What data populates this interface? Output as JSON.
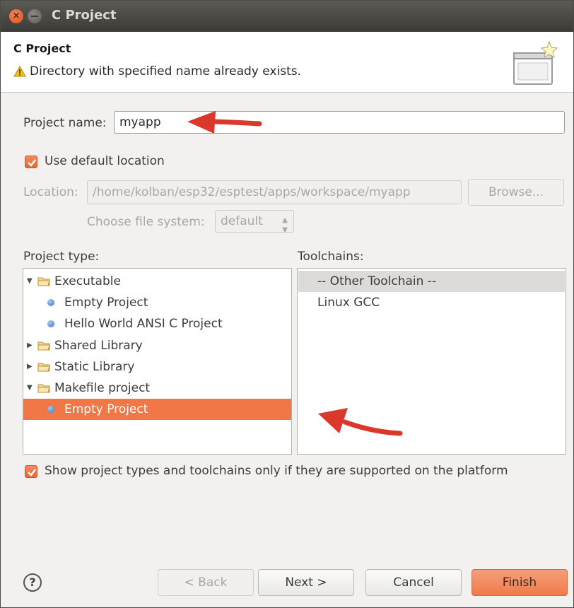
{
  "window": {
    "title": "C Project"
  },
  "banner": {
    "title": "C Project",
    "message": "Directory with specified name already exists."
  },
  "project_name": {
    "label": "Project name:",
    "value": "myapp"
  },
  "use_default_location": {
    "label": "Use default location",
    "checked": true
  },
  "location": {
    "label": "Location:",
    "value": "/home/kolban/esp32/esptest/apps/workspace/myapp",
    "browse_label": "Browse..."
  },
  "file_system": {
    "label": "Choose file system:",
    "value": "default"
  },
  "project_type": {
    "header": "Project type:",
    "items": [
      {
        "label": "Executable",
        "kind": "folder",
        "expanded": true
      },
      {
        "label": "Empty Project",
        "kind": "item"
      },
      {
        "label": "Hello World ANSI C Project",
        "kind": "item"
      },
      {
        "label": "Shared Library",
        "kind": "folder",
        "expanded": false
      },
      {
        "label": "Static Library",
        "kind": "folder",
        "expanded": false
      },
      {
        "label": "Makefile project",
        "kind": "folder",
        "expanded": true
      },
      {
        "label": "Empty Project",
        "kind": "item",
        "selected": true
      }
    ]
  },
  "toolchains": {
    "header": "Toolchains:",
    "items": [
      {
        "label": "-- Other Toolchain --",
        "selected": true
      },
      {
        "label": "Linux GCC"
      }
    ]
  },
  "show_supported": {
    "label": "Show project types and toolchains only if they are supported on the platform",
    "checked": true
  },
  "buttons": {
    "help": "?",
    "back": "< Back",
    "next": "Next >",
    "cancel": "Cancel",
    "finish": "Finish"
  },
  "colors": {
    "accent": "#f07746",
    "annotation_arrow": "#d9382b",
    "titlebar": "#3c3b37"
  },
  "icons": {
    "close": "close-icon",
    "minimize": "minimize-icon",
    "warning": "warning-icon",
    "wizard": "wizard-banner-icon",
    "folder": "folder-icon",
    "bullet": "bullet-icon"
  }
}
